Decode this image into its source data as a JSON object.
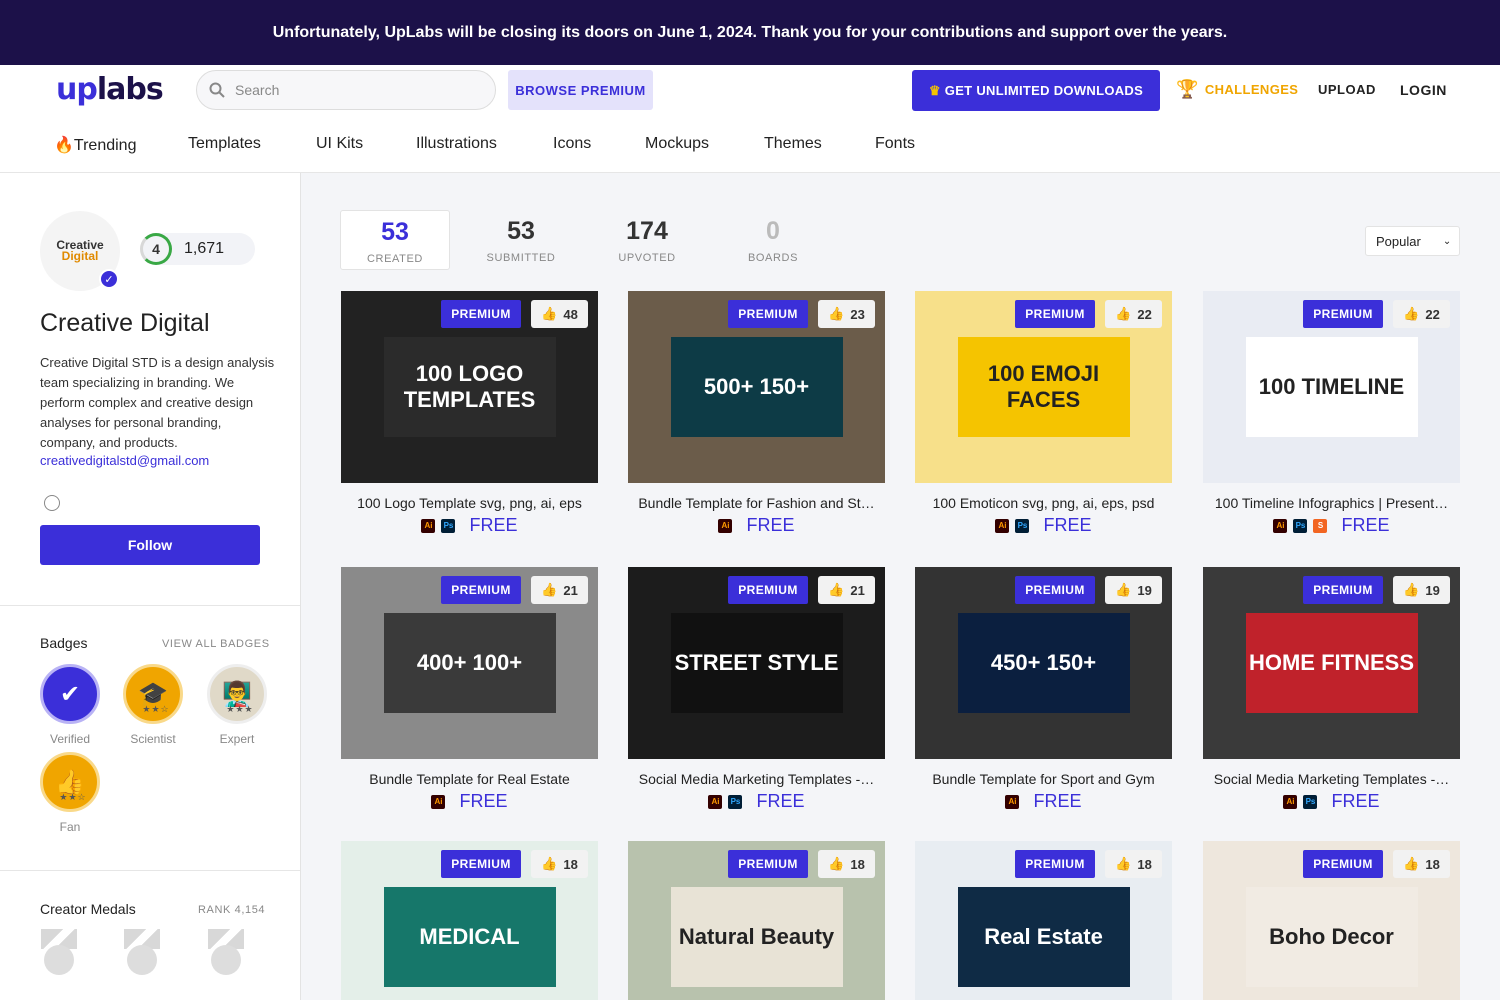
{
  "banner": "Unfortunately, UpLabs will be closing its doors on June 1, 2024. Thank you for your contributions and support over the years.",
  "header": {
    "logo_up": "up",
    "logo_labs": "labs",
    "search_placeholder": "Search",
    "browse_premium": "BROWSE PREMIUM",
    "unlimited": "GET UNLIMITED DOWNLOADS",
    "challenges": "CHALLENGES",
    "upload": "UPLOAD",
    "login": "LOGIN"
  },
  "categories": [
    "🔥Trending",
    "Templates",
    "UI Kits",
    "Illustrations",
    "Icons",
    "Mockups",
    "Themes",
    "Fonts"
  ],
  "profile": {
    "avatar_line1": "Creative",
    "avatar_line2": "Digital",
    "level": "4",
    "points": "1,671",
    "name": "Creative Digital",
    "bio": "Creative Digital STD is a design analysis team specializing in branding. We perform complex and creative design analyses for personal branding, company, and products.",
    "email": "creativedigitalstd@gmail.com",
    "follow": "Follow"
  },
  "badges": {
    "title": "Badges",
    "view_all": "VIEW ALL BADGES",
    "items": [
      {
        "label": "Verified",
        "icon": "check-icon",
        "color": "#3b2fd9"
      },
      {
        "label": "Scientist",
        "icon": "graduation-cap-icon",
        "color": "#f0a500"
      },
      {
        "label": "Expert",
        "icon": "expert-person-icon",
        "color": "#e0d9c8"
      },
      {
        "label": "Fan",
        "icon": "thumbs-up-icon",
        "color": "#f0a500"
      }
    ]
  },
  "medals": {
    "title": "Creator Medals",
    "rank": "RANK 4,154"
  },
  "stats": [
    {
      "n": "53",
      "l": "CREATED"
    },
    {
      "n": "53",
      "l": "SUBMITTED"
    },
    {
      "n": "174",
      "l": "UPVOTED"
    },
    {
      "n": "0",
      "l": "BOARDS"
    }
  ],
  "sort": "Popular",
  "premium_label": "PREMIUM",
  "free_label": "FREE",
  "cards": [
    {
      "title": "100 Logo Template svg, png, ai, eps",
      "likes": "48",
      "thumb_text": "100 LOGO TEMPLATES",
      "tools": [
        "ai",
        "ps"
      ],
      "bg": "#222222",
      "panel": "#2b2b2b"
    },
    {
      "title": "Bundle Template for Fashion and St…",
      "likes": "23",
      "thumb_text": "500+ 150+",
      "tools": [
        "ai"
      ],
      "bg": "#6b5c4a",
      "panel": "#0d3b46"
    },
    {
      "title": "100 Emoticon svg, png, ai, eps, psd",
      "likes": "22",
      "thumb_text": "100 EMOJI FACES",
      "tools": [
        "ai",
        "ps"
      ],
      "bg": "#f7e08a",
      "panel": "#f5c400"
    },
    {
      "title": "100 Timeline Infographics | Present…",
      "likes": "22",
      "thumb_text": "100 TIMELINE",
      "tools": [
        "ai",
        "ps",
        "sk"
      ],
      "bg": "#e9ecf3",
      "panel": "#ffffff"
    },
    {
      "title": "Bundle Template for Real Estate",
      "likes": "21",
      "thumb_text": "400+ 100+",
      "tools": [
        "ai"
      ],
      "bg": "#8a8a8a",
      "panel": "#3a3a3a"
    },
    {
      "title": "Social Media Marketing Templates -…",
      "likes": "21",
      "thumb_text": "STREET STYLE",
      "tools": [
        "ai",
        "ps"
      ],
      "bg": "#1c1c1c",
      "panel": "#111111"
    },
    {
      "title": "Bundle Template for Sport and Gym",
      "likes": "19",
      "thumb_text": "450+ 150+",
      "tools": [
        "ai"
      ],
      "bg": "#333333",
      "panel": "#0b1f3f"
    },
    {
      "title": "Social Media Marketing Templates -…",
      "likes": "19",
      "thumb_text": "HOME FITNESS",
      "tools": [
        "ai",
        "ps"
      ],
      "bg": "#3a3a3a",
      "panel": "#c0222b"
    },
    {
      "title": "",
      "likes": "18",
      "thumb_text": "MEDICAL",
      "tools": [],
      "bg": "#e4efe9",
      "panel": "#16776a"
    },
    {
      "title": "",
      "likes": "18",
      "thumb_text": "Natural Beauty",
      "tools": [],
      "bg": "#b8c2ad",
      "panel": "#e8e3d6"
    },
    {
      "title": "",
      "likes": "18",
      "thumb_text": "Real Estate",
      "tools": [],
      "bg": "#e8edf2",
      "panel": "#0f2b45"
    },
    {
      "title": "",
      "likes": "18",
      "thumb_text": "Boho Decor",
      "tools": [],
      "bg": "#eee7dd",
      "panel": "#f1ebe3"
    }
  ]
}
